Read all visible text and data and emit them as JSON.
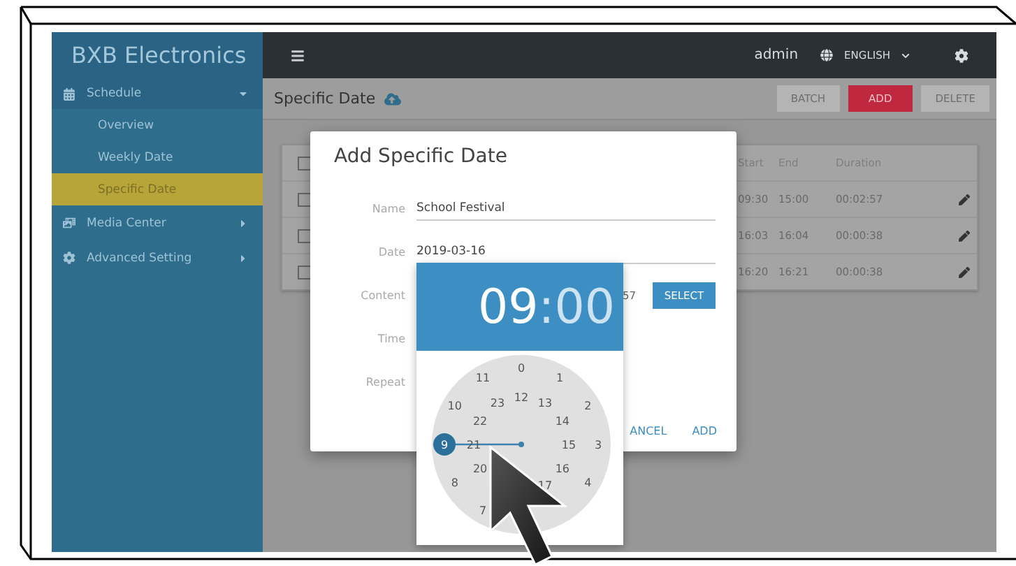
{
  "sidebar": {
    "brand": "BXB Electronics",
    "items": [
      {
        "label": "Schedule",
        "expanded": true,
        "selected": false,
        "children": [
          {
            "label": "Overview",
            "selected": false
          },
          {
            "label": "Weekly Date",
            "selected": false
          },
          {
            "label": "Specific Date",
            "selected": true
          }
        ]
      },
      {
        "label": "Media Center",
        "expanded": false,
        "selected": false
      },
      {
        "label": "Advanced Setting",
        "expanded": false,
        "selected": false
      }
    ]
  },
  "topbar": {
    "user": "admin",
    "language": "ENGLISH"
  },
  "page": {
    "title": "Specific Date",
    "buttons": [
      {
        "label": "BATCH",
        "kind": "plain",
        "disabled": true
      },
      {
        "label": "ADD",
        "kind": "primary",
        "disabled": false
      },
      {
        "label": "DELETE",
        "kind": "plain",
        "disabled": true
      }
    ]
  },
  "table": {
    "columns": [
      "Start",
      "End",
      "Duration"
    ],
    "header_checked": false,
    "rows": [
      {
        "checked": false,
        "start": "09:30",
        "end": "15:00",
        "duration": "00:02:57"
      },
      {
        "checked": false,
        "start": "16:03",
        "end": "16:04",
        "duration": "00:00:38"
      },
      {
        "checked": false,
        "start": "16:20",
        "end": "16:21",
        "duration": "00:00:38"
      }
    ]
  },
  "dialog": {
    "title": "Add Specific Date",
    "fields": [
      {
        "kind": "text",
        "label": "Name",
        "value": "School Festival"
      },
      {
        "kind": "text",
        "label": "Date",
        "value": "2019-03-16"
      },
      {
        "kind": "select",
        "label": "Content",
        "value": "57",
        "action": "SELECT"
      },
      {
        "kind": "hidden",
        "label": "Time"
      },
      {
        "kind": "hidden",
        "label": "Repeat"
      }
    ],
    "buttons": [
      "ANCEL",
      "ADD"
    ]
  },
  "time_picker": {
    "hour": "09",
    "separator": ":",
    "minute": "00",
    "hours": [
      {
        "label": "0",
        "selected": false
      },
      {
        "label": "1",
        "selected": false
      },
      {
        "label": "2",
        "selected": false
      },
      {
        "label": "3",
        "selected": false
      },
      {
        "label": "4",
        "selected": false
      },
      {
        "label": "7",
        "selected": false
      },
      {
        "label": "8",
        "selected": false
      },
      {
        "label": "9",
        "selected": true
      },
      {
        "label": "10",
        "selected": false
      },
      {
        "label": "11",
        "selected": false
      },
      {
        "label": "12",
        "selected": false
      },
      {
        "label": "13",
        "selected": false
      },
      {
        "label": "14",
        "selected": false
      },
      {
        "label": "15",
        "selected": false
      },
      {
        "label": "16",
        "selected": false
      },
      {
        "label": "17",
        "selected": false
      },
      {
        "label": "20",
        "selected": false
      },
      {
        "label": "21",
        "selected": false
      },
      {
        "label": "22",
        "selected": false
      },
      {
        "label": "23",
        "selected": false
      }
    ]
  }
}
